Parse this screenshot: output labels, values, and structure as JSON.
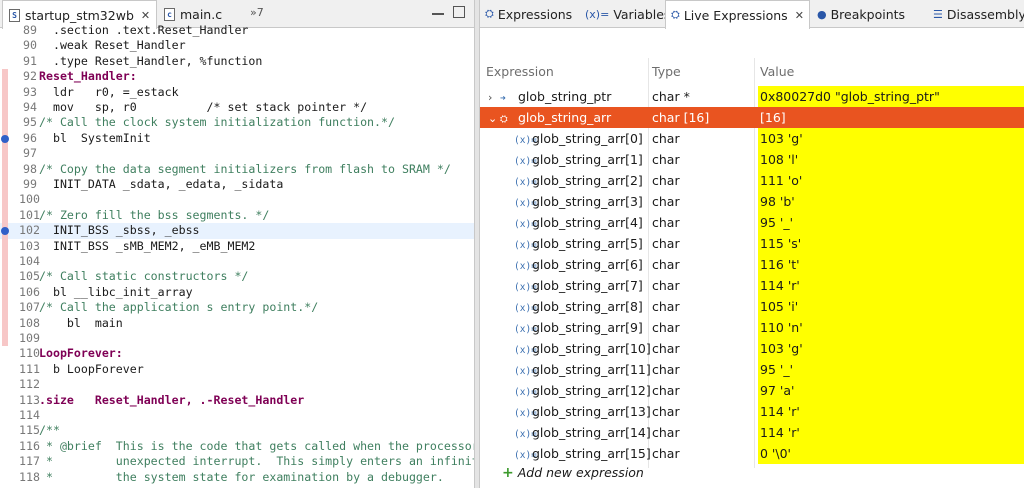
{
  "editor": {
    "tabs": [
      {
        "label": "startup_stm32wb",
        "icon": "S",
        "close": "✕"
      },
      {
        "label": "main.c",
        "icon": "c"
      }
    ],
    "overflow": "»7",
    "lines": [
      {
        "n": "89",
        "t": "  .section .text.Reset_Handler"
      },
      {
        "n": "90",
        "t": "  .weak Reset_Handler"
      },
      {
        "n": "91",
        "t": "  .type Reset_Handler, %function"
      },
      {
        "n": "92",
        "t": "Reset_Handler:"
      },
      {
        "n": "93",
        "t": "  ldr   r0, =_estack"
      },
      {
        "n": "94",
        "t": "  mov   sp, r0          /* set stack pointer */"
      },
      {
        "n": "95",
        "t": "/* Call the clock system initialization function.*/"
      },
      {
        "n": "96",
        "t": "  bl  SystemInit"
      },
      {
        "n": "97",
        "t": ""
      },
      {
        "n": "98",
        "t": "/* Copy the data segment initializers from flash to SRAM */"
      },
      {
        "n": "99",
        "t": "  INIT_DATA _sdata, _edata, _sidata"
      },
      {
        "n": "100",
        "t": ""
      },
      {
        "n": "101",
        "t": "/* Zero fill the bss segments. */"
      },
      {
        "n": "102",
        "t": "  INIT_BSS _sbss, _ebss"
      },
      {
        "n": "103",
        "t": "  INIT_BSS _sMB_MEM2, _eMB_MEM2"
      },
      {
        "n": "104",
        "t": ""
      },
      {
        "n": "105",
        "t": "/* Call static constructors */"
      },
      {
        "n": "106",
        "t": "  bl __libc_init_array"
      },
      {
        "n": "107",
        "t": "/* Call the application s entry point.*/"
      },
      {
        "n": "108",
        "t": "    bl  main"
      },
      {
        "n": "109",
        "t": ""
      },
      {
        "n": "110",
        "t": "LoopForever:"
      },
      {
        "n": "111",
        "t": "  b LoopForever"
      },
      {
        "n": "112",
        "t": ""
      },
      {
        "n": "113",
        "t": ".size   Reset_Handler, .-Reset_Handler"
      },
      {
        "n": "114",
        "t": ""
      },
      {
        "n": "115",
        "t": "/**"
      },
      {
        "n": "116",
        "t": " * @brief  This is the code that gets called when the processor receives an"
      },
      {
        "n": "117",
        "t": " *         unexpected interrupt.  This simply enters an infinite loop, preserving"
      },
      {
        "n": "118",
        "t": " *         the system state for examination by a debugger."
      }
    ]
  },
  "views": {
    "tabs": [
      {
        "label": "Expressions",
        "icon": "⛭"
      },
      {
        "label": "Variables",
        "icon": "(x)="
      },
      {
        "label": "Live Expressions",
        "icon": "⛭",
        "close": "✕"
      },
      {
        "label": "Breakpoints",
        "icon": "●"
      },
      {
        "label": "Disassembly",
        "icon": "☰"
      }
    ],
    "columns": {
      "expression": "Expression",
      "type": "Type",
      "value": "Value"
    },
    "rows": [
      {
        "expr": "glob_string_ptr",
        "type": "char *",
        "value": "0x80027d0 \"glob_string_ptr\"",
        "twisty": "›",
        "icon": "➜"
      },
      {
        "expr": "glob_string_arr",
        "type": "char [16]",
        "value": "[16]",
        "twisty": "⌄",
        "icon": "⛭"
      },
      {
        "expr": "glob_string_arr[0]",
        "type": "char",
        "value": "103 'g'",
        "icon": "(x)="
      },
      {
        "expr": "glob_string_arr[1]",
        "type": "char",
        "value": "108 'l'",
        "icon": "(x)="
      },
      {
        "expr": "glob_string_arr[2]",
        "type": "char",
        "value": "111 'o'",
        "icon": "(x)="
      },
      {
        "expr": "glob_string_arr[3]",
        "type": "char",
        "value": "98 'b'",
        "icon": "(x)="
      },
      {
        "expr": "glob_string_arr[4]",
        "type": "char",
        "value": "95 '_'",
        "icon": "(x)="
      },
      {
        "expr": "glob_string_arr[5]",
        "type": "char",
        "value": "115 's'",
        "icon": "(x)="
      },
      {
        "expr": "glob_string_arr[6]",
        "type": "char",
        "value": "116 't'",
        "icon": "(x)="
      },
      {
        "expr": "glob_string_arr[7]",
        "type": "char",
        "value": "114 'r'",
        "icon": "(x)="
      },
      {
        "expr": "glob_string_arr[8]",
        "type": "char",
        "value": "105 'i'",
        "icon": "(x)="
      },
      {
        "expr": "glob_string_arr[9]",
        "type": "char",
        "value": "110 'n'",
        "icon": "(x)="
      },
      {
        "expr": "glob_string_arr[10]",
        "type": "char",
        "value": "103 'g'",
        "icon": "(x)="
      },
      {
        "expr": "glob_string_arr[11]",
        "type": "char",
        "value": "95 '_'",
        "icon": "(x)="
      },
      {
        "expr": "glob_string_arr[12]",
        "type": "char",
        "value": "97 'a'",
        "icon": "(x)="
      },
      {
        "expr": "glob_string_arr[13]",
        "type": "char",
        "value": "114 'r'",
        "icon": "(x)="
      },
      {
        "expr": "glob_string_arr[14]",
        "type": "char",
        "value": "114 'r'",
        "icon": "(x)="
      },
      {
        "expr": "glob_string_arr[15]",
        "type": "char",
        "value": "0 '\\0'",
        "icon": "(x)="
      }
    ],
    "add_label": "Add new expression",
    "add_icon": "+"
  },
  "colors": {
    "selection": "#e95420",
    "value_highlight": "#ffff00",
    "keyword": "#7f0055",
    "comment": "#3f7f5f"
  }
}
